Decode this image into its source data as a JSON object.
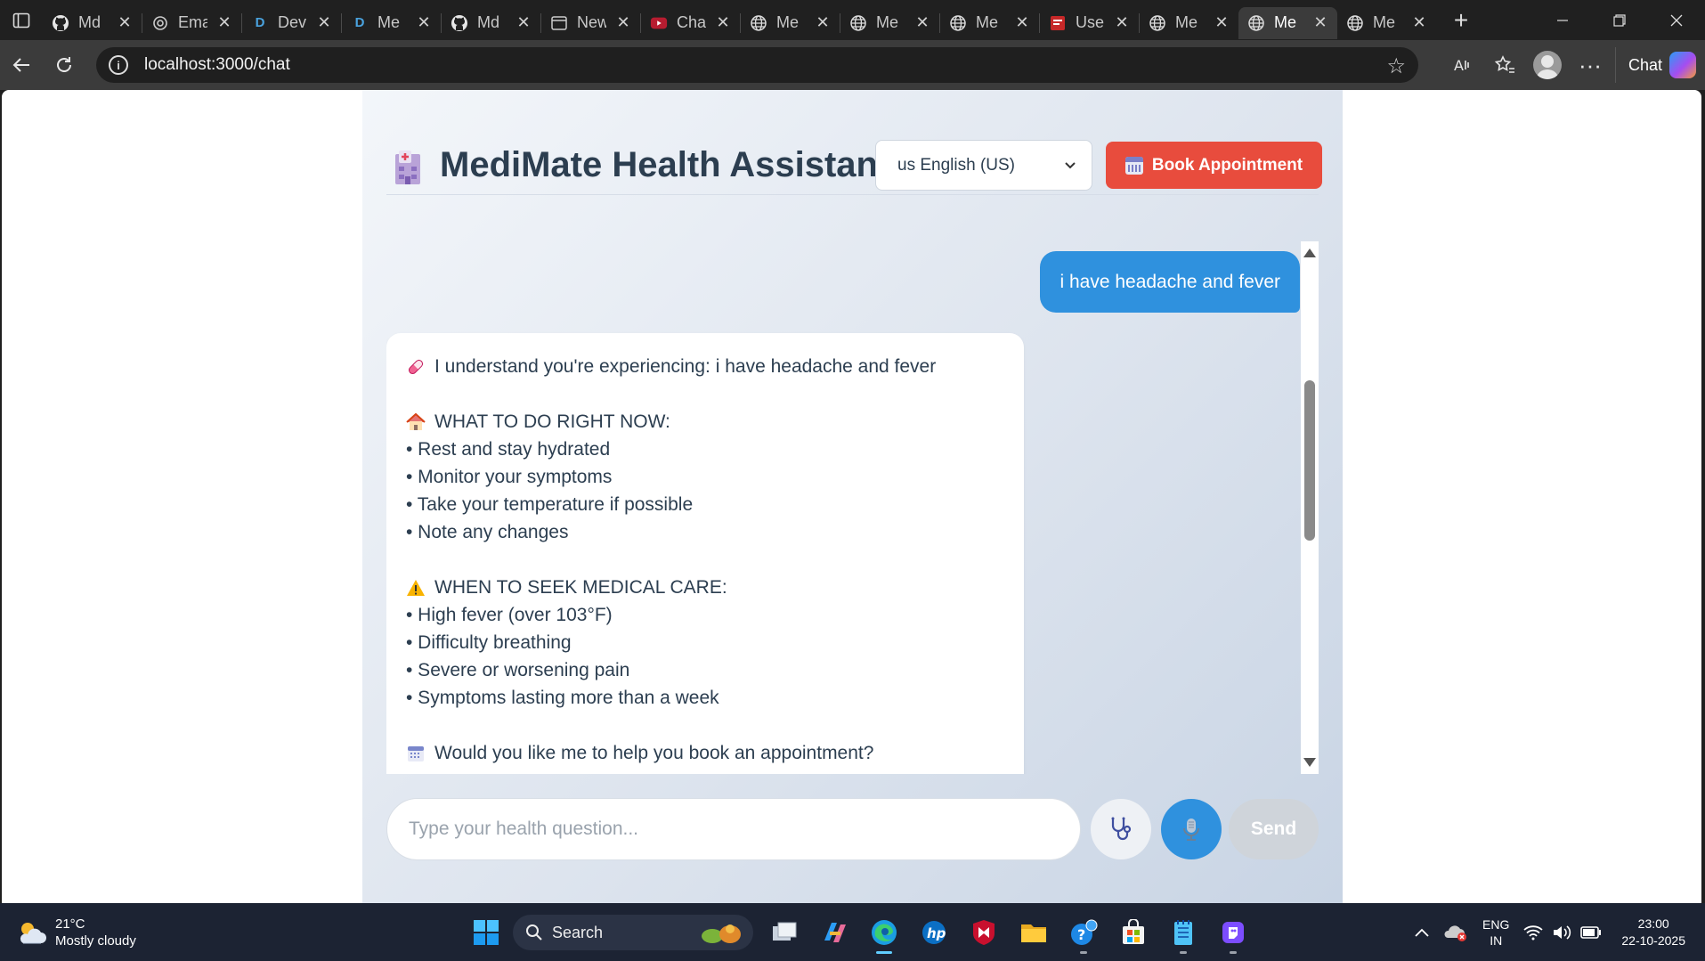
{
  "browser": {
    "tabs": [
      {
        "title": "Md",
        "icon": "github-icon",
        "active": false
      },
      {
        "title": "Ema",
        "icon": "openai-icon",
        "active": false
      },
      {
        "title": "Dev",
        "icon": "devpost-icon",
        "active": false
      },
      {
        "title": "Me",
        "icon": "devpost-icon",
        "active": false
      },
      {
        "title": "Md",
        "icon": "github-icon",
        "active": false
      },
      {
        "title": "New",
        "icon": "newtab-icon",
        "active": false
      },
      {
        "title": "Cha",
        "icon": "youtube-icon",
        "active": false
      },
      {
        "title": "Me",
        "icon": "globe-icon",
        "active": false
      },
      {
        "title": "Me",
        "icon": "globe-icon",
        "active": false
      },
      {
        "title": "Me",
        "icon": "globe-icon",
        "active": false
      },
      {
        "title": "Use",
        "icon": "pdf-icon",
        "active": false
      },
      {
        "title": "Me",
        "icon": "globe-icon",
        "active": false
      },
      {
        "title": "Me",
        "icon": "globe-icon",
        "active": true
      },
      {
        "title": "Me",
        "icon": "globe-icon",
        "active": false
      }
    ],
    "url": "localhost:3000/chat",
    "copilot_label": "Chat"
  },
  "app": {
    "title": "MediMate Health Assistant",
    "language": "us English (US)",
    "book_button_label": "Book Appointment",
    "accent_color": "#e84c3d",
    "primary_color": "#2f91de"
  },
  "chat": {
    "user_message": "i have headache and fever",
    "bot_lines": [
      {
        "icon": "pill-icon",
        "text": "I understand you're experiencing: i have headache and fever"
      },
      {
        "icon": null,
        "text": ""
      },
      {
        "icon": "house-icon",
        "text": "WHAT TO DO RIGHT NOW:"
      },
      {
        "icon": null,
        "text": "• Rest and stay hydrated"
      },
      {
        "icon": null,
        "text": "• Monitor your symptoms"
      },
      {
        "icon": null,
        "text": "• Take your temperature if possible"
      },
      {
        "icon": null,
        "text": "• Note any changes"
      },
      {
        "icon": null,
        "text": ""
      },
      {
        "icon": "warning-icon",
        "text": "WHEN TO SEEK MEDICAL CARE:"
      },
      {
        "icon": null,
        "text": "• High fever (over 103°F)"
      },
      {
        "icon": null,
        "text": "• Difficulty breathing"
      },
      {
        "icon": null,
        "text": "• Severe or worsening pain"
      },
      {
        "icon": null,
        "text": "• Symptoms lasting more than a week"
      },
      {
        "icon": null,
        "text": ""
      },
      {
        "icon": "calendar-icon",
        "text": "Would you like me to help you book an appointment?"
      }
    ]
  },
  "composer": {
    "placeholder": "Type your health question...",
    "value": "",
    "send_label": "Send"
  },
  "taskbar": {
    "weather_temp": "21°C",
    "weather_desc": "Mostly cloudy",
    "search_label": "Search",
    "lang_line1": "ENG",
    "lang_line2": "IN",
    "time": "23:00",
    "date": "22-10-2025"
  }
}
